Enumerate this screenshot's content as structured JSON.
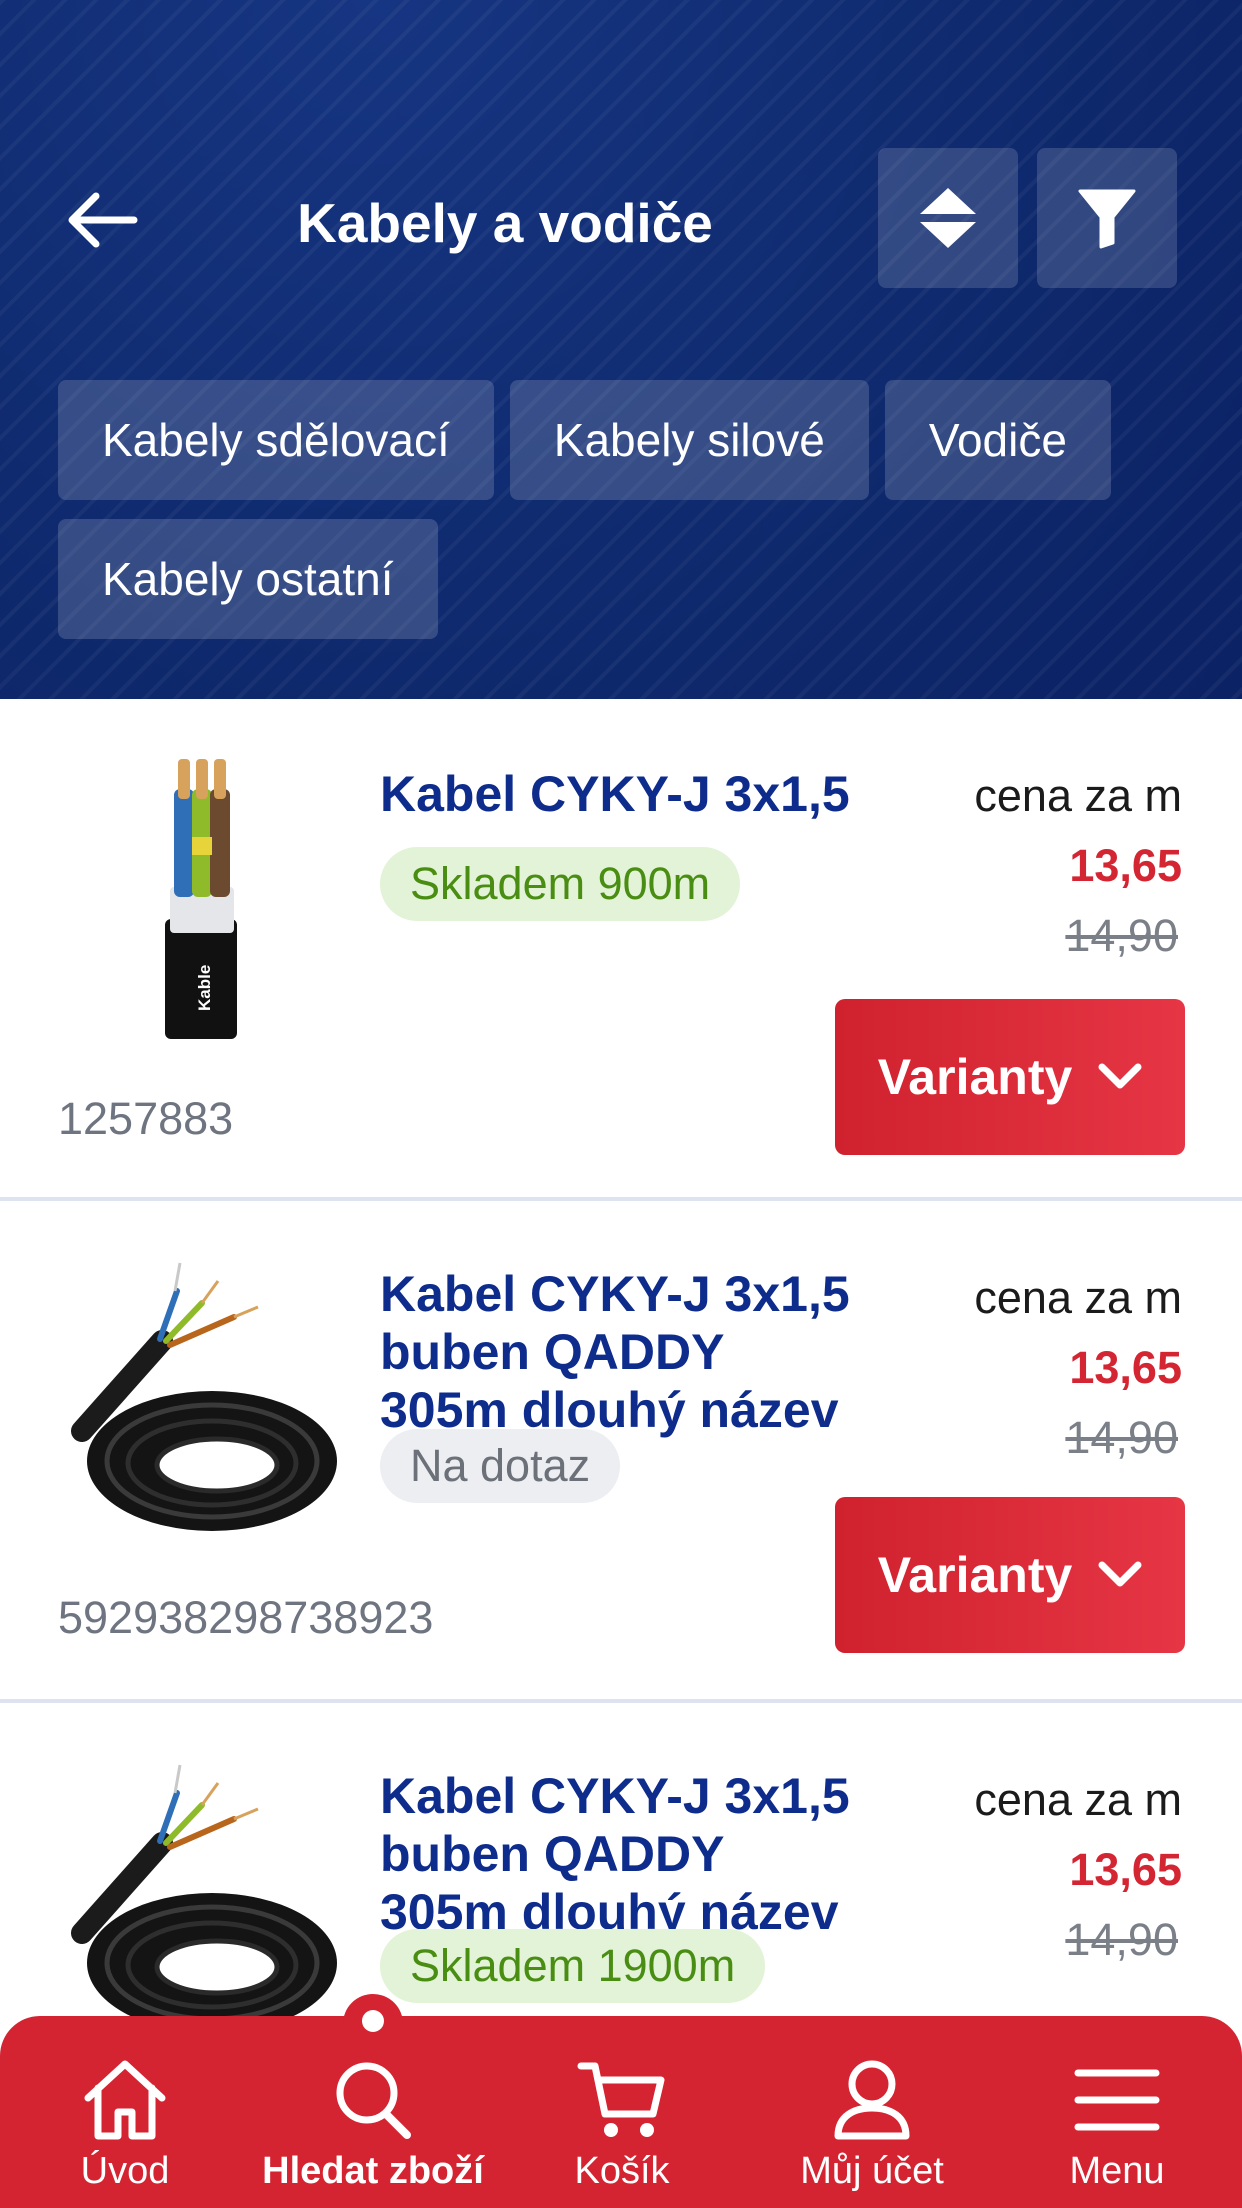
{
  "header": {
    "title": "Kabely a vodiče",
    "back_icon": "arrow-left-icon",
    "sort_icon": "sort-icon",
    "filter_icon": "filter-icon"
  },
  "categories": [
    "Kabely sdělovací",
    "Kabely silové",
    "Vodiče",
    "Kabely ostatní"
  ],
  "products": [
    {
      "name": "Kabel CYKY-J 3x1,5",
      "stock_label": "Skladem 900m",
      "stock_status": "in-stock",
      "sku": "1257883",
      "price_label": "cena za m",
      "price": "13,65",
      "old_price": "14,90",
      "button_label": "Varianty",
      "image_text": "Kable"
    },
    {
      "name": "Kabel CYKY-J 3x1,5 buben QADDY 305m dlouhý název",
      "stock_label": "Na dotaz",
      "stock_status": "on-request",
      "sku": "592938298738923",
      "price_label": "cena za m",
      "price": "13,65",
      "old_price": "14,90",
      "button_label": "Varianty"
    },
    {
      "name": "Kabel CYKY-J 3x1,5 buben QADDY 305m dlouhý název",
      "stock_label": "Skladem 1900m",
      "stock_status": "in-stock",
      "price_label": "cena za m",
      "price": "13,65",
      "old_price": "14,90"
    }
  ],
  "bottom_nav": [
    {
      "label": "Úvod",
      "icon": "home-icon",
      "active": false
    },
    {
      "label": "Hledat zboží",
      "icon": "search-icon",
      "active": true
    },
    {
      "label": "Košík",
      "icon": "cart-icon",
      "active": false
    },
    {
      "label": "Můj účet",
      "icon": "user-icon",
      "active": false
    },
    {
      "label": "Menu",
      "icon": "menu-icon",
      "active": false
    }
  ],
  "colors": {
    "header_bg": "#0f2a6e",
    "accent_red": "#d42331",
    "product_name": "#0e2c8c",
    "stock_green": "#4a8d13"
  }
}
